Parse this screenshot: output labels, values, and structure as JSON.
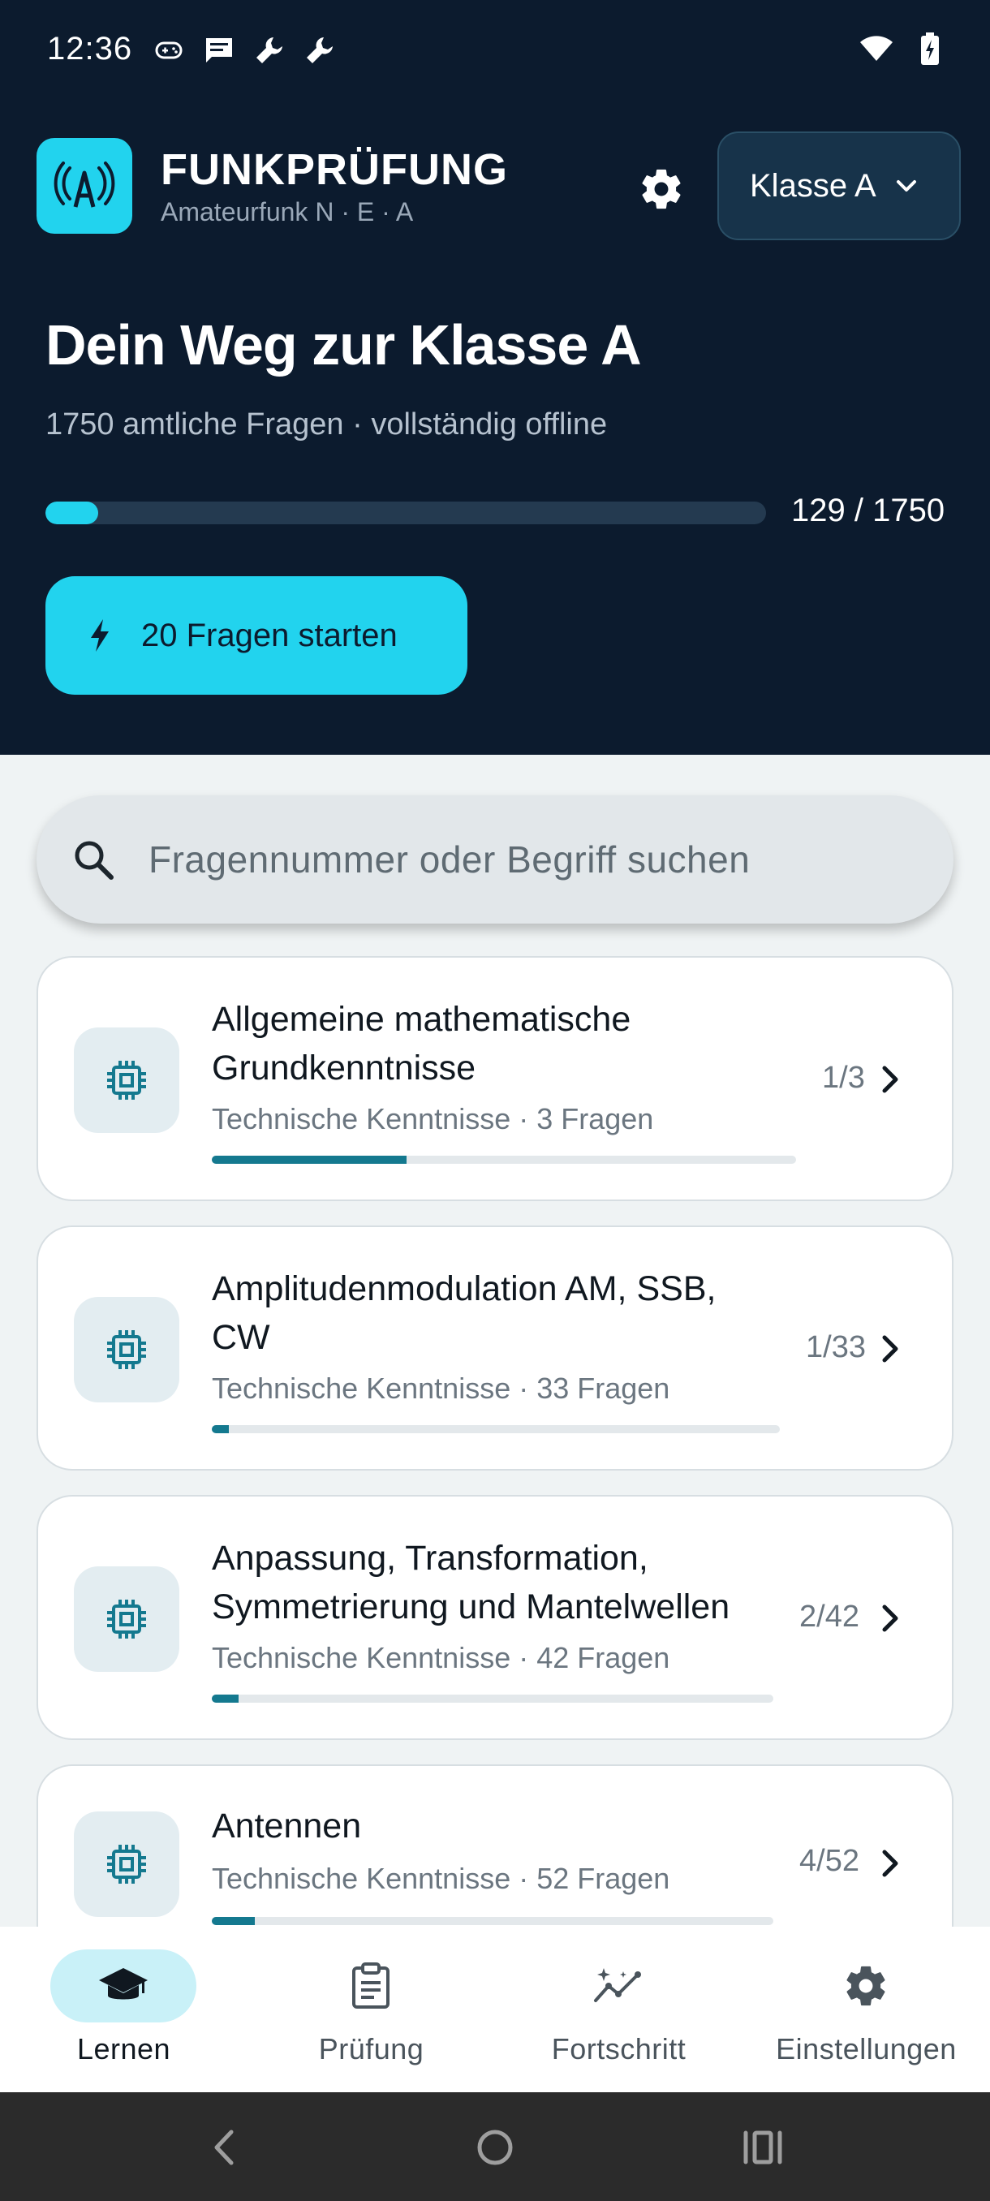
{
  "status_bar": {
    "time": "12:36",
    "left_icons": [
      "gamepad-icon",
      "message-icon",
      "wrench-icon",
      "wrench-icon"
    ],
    "right_icons": [
      "wifi-icon",
      "battery-charging-icon"
    ]
  },
  "app_bar": {
    "title": "FUNKPRÜFUNG",
    "subtitle": "Amateurfunk N · E · A",
    "class_select": "Klasse A"
  },
  "hero": {
    "title": "Dein Weg zur Klasse A",
    "subtitle": "1750 amtliche Fragen · vollständig offline",
    "progress_text": "129 / 1750",
    "progress_value": 0.0737,
    "start_button": "20 Fragen starten"
  },
  "search": {
    "placeholder": "Fragennummer oder Begriff suchen"
  },
  "topics": [
    {
      "title_line1": "Allgemeine mathematische",
      "title_line2": "Grundkenntnisse",
      "meta": "Technische Kenntnisse · 3 Fragen",
      "count": "1/3",
      "progress": 0.333
    },
    {
      "title_line1": "Amplitudenmodulation AM, SSB,",
      "title_line2": "CW",
      "meta": "Technische Kenntnisse · 33 Fragen",
      "count": "1/33",
      "progress": 0.03
    },
    {
      "title_line1": "Anpassung, Transformation,",
      "title_line2": "Symmetrierung und Mantelwellen",
      "meta": "Technische Kenntnisse · 42 Fragen",
      "count": "2/42",
      "progress": 0.048
    },
    {
      "title_line1": "Antennen",
      "title_line2": "",
      "meta": "Technische Kenntnisse · 52 Fragen",
      "count": "4/52",
      "progress": 0.077
    }
  ],
  "bottom_nav": {
    "items": [
      {
        "label": "Lernen",
        "icon": "graduation-cap-icon",
        "active": true
      },
      {
        "label": "Prüfung",
        "icon": "clipboard-icon",
        "active": false
      },
      {
        "label": "Fortschritt",
        "icon": "chart-sparkle-icon",
        "active": false
      },
      {
        "label": "Einstellungen",
        "icon": "gear-icon",
        "active": false
      }
    ]
  },
  "colors": {
    "header_bg": "#0c1b2e",
    "accent": "#22d3ee",
    "topic_progress": "#14798f",
    "page_bg": "#eff3f4"
  }
}
